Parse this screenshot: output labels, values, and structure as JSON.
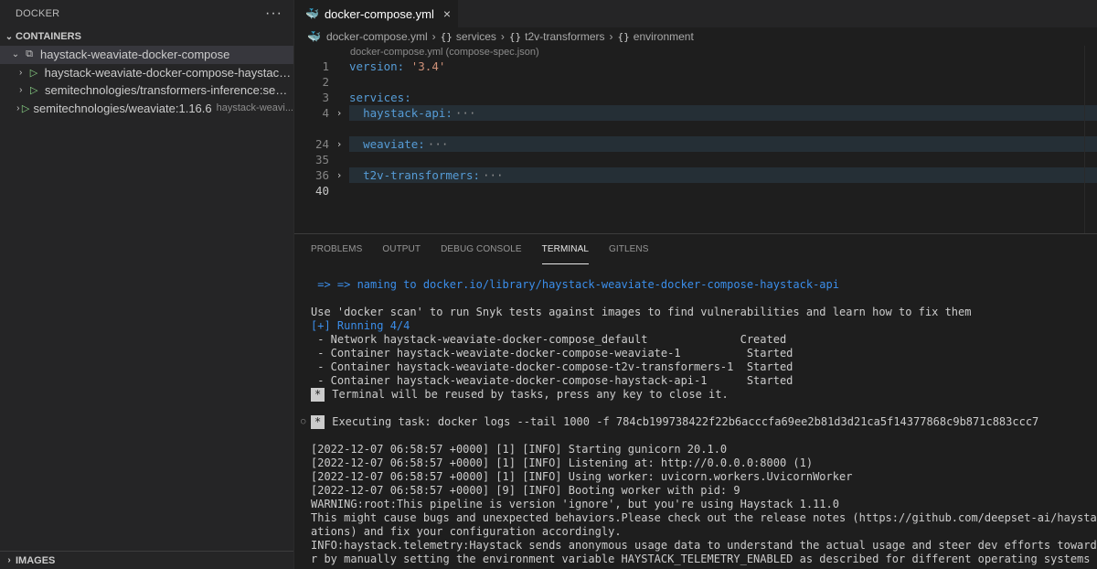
{
  "sidebar": {
    "title": "DOCKER",
    "more": "···",
    "section_containers": "CONTAINERS",
    "section_images": "IMAGES",
    "compose_group": "haystack-weaviate-docker-compose",
    "containers": [
      {
        "name": "haystack-weaviate-docker-compose-haystack-a...",
        "detail": ""
      },
      {
        "name": "semitechnologies/transformers-inference:sente...",
        "detail": ""
      },
      {
        "name": "semitechnologies/weaviate:1.16.6",
        "detail": "haystack-weavi..."
      }
    ]
  },
  "editor": {
    "tab_label": "docker-compose.yml",
    "tab_close": "×",
    "breadcrumb": {
      "file": "docker-compose.yml",
      "seg1": "services",
      "seg2": "t2v-transformers",
      "seg3": "environment"
    },
    "schema": "docker-compose.yml (compose-spec.json)",
    "lines": {
      "n1": "1",
      "n2": "2",
      "n3": "3",
      "n4": "4",
      "n24": "24",
      "n35": "35",
      "n36": "36",
      "n40": "40",
      "version_key": "version:",
      "version_val": "'3.4'",
      "services_key": "services:",
      "svc1": "haystack-api:",
      "svc2": "weaviate:",
      "svc3": "t2v-transformers:",
      "ellipsis": "···"
    }
  },
  "panel": {
    "tabs": [
      "PROBLEMS",
      "OUTPUT",
      "DEBUG CONSOLE",
      "TERMINAL",
      "GITLENS"
    ],
    "active_tab": "TERMINAL",
    "terminal": {
      "naming": " => => naming to docker.io/library/haystack-weaviate-docker-compose-haystack-api",
      "scan": "Use 'docker scan' to run Snyk tests against images to find vulnerabilities and learn how to fix them",
      "running": "[+] Running 4/4",
      "r1": " - Network haystack-weaviate-docker-compose_default              Created",
      "r2": " - Container haystack-weaviate-docker-compose-weaviate-1          Started",
      "r3": " - Container haystack-weaviate-docker-compose-t2v-transformers-1  Started",
      "r4": " - Container haystack-weaviate-docker-compose-haystack-api-1      Started",
      "badge": "*",
      "reuse": "Terminal will be reused by tasks, press any key to close it.",
      "exec": "Executing task: docker logs --tail 1000 -f 784cb199738422f22b6acccfa69ee2b81d3d21ca5f14377868c9b871c883ccc7",
      "log1": "[2022-12-07 06:58:57 +0000] [1] [INFO] Starting gunicorn 20.1.0",
      "log2": "[2022-12-07 06:58:57 +0000] [1] [INFO] Listening at: http://0.0.0.0:8000 (1)",
      "log3": "[2022-12-07 06:58:57 +0000] [1] [INFO] Using worker: uvicorn.workers.UvicornWorker",
      "log4": "[2022-12-07 06:58:57 +0000] [9] [INFO] Booting worker with pid: 9",
      "warn": "WARNING:root:This pipeline is version 'ignore', but you're using Haystack 1.11.0",
      "bugs": "This might cause bugs and unexpected behaviors.Please check out the release notes (https://github.com/deepset-ai/haystack/releas",
      "bugs2": "ations) and fix your configuration accordingly.",
      "tele": "INFO:haystack.telemetry:Haystack sends anonymous usage data to understand the actual usage and steer dev efforts towards feature",
      "tele2": "r by manually setting the environment variable HAYSTACK_TELEMETRY_ENABLED as described for different operating systems on the do"
    }
  }
}
